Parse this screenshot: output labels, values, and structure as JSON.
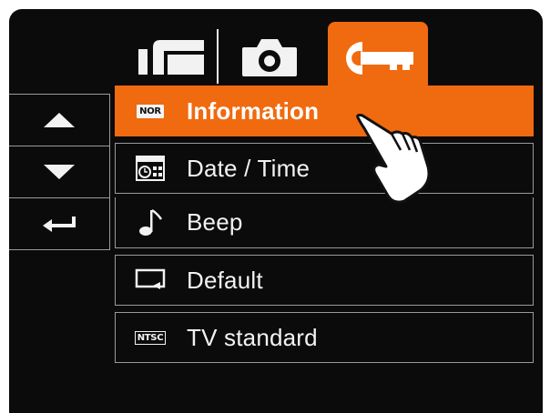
{
  "tabs": {
    "display_icon": "display-mode-icon",
    "camera_icon": "camera-icon",
    "setup_icon": "wrench-icon",
    "active": "setup"
  },
  "nav": {
    "up_icon": "arrow-up-icon",
    "down_icon": "arrow-down-icon",
    "enter_icon": "return-icon"
  },
  "menu": {
    "items": [
      {
        "label": "Information",
        "icon": "nor-badge-icon",
        "badge": "NOR",
        "selected": true
      },
      {
        "label": "Date / Time",
        "icon": "date-time-icon",
        "selected": false
      },
      {
        "label": "Beep",
        "icon": "music-note-icon",
        "selected": false
      },
      {
        "label": "Default",
        "icon": "default-screen-icon",
        "selected": false
      },
      {
        "label": "TV standard",
        "icon": "ntsc-badge-icon",
        "badge": "NTSC",
        "selected": false
      }
    ]
  },
  "colors": {
    "accent": "#f06a0f",
    "background": "#0b0b0b",
    "border": "#9a9a9a",
    "text": "#f2f2f2"
  },
  "pointer_icon": "pointing-hand-icon"
}
